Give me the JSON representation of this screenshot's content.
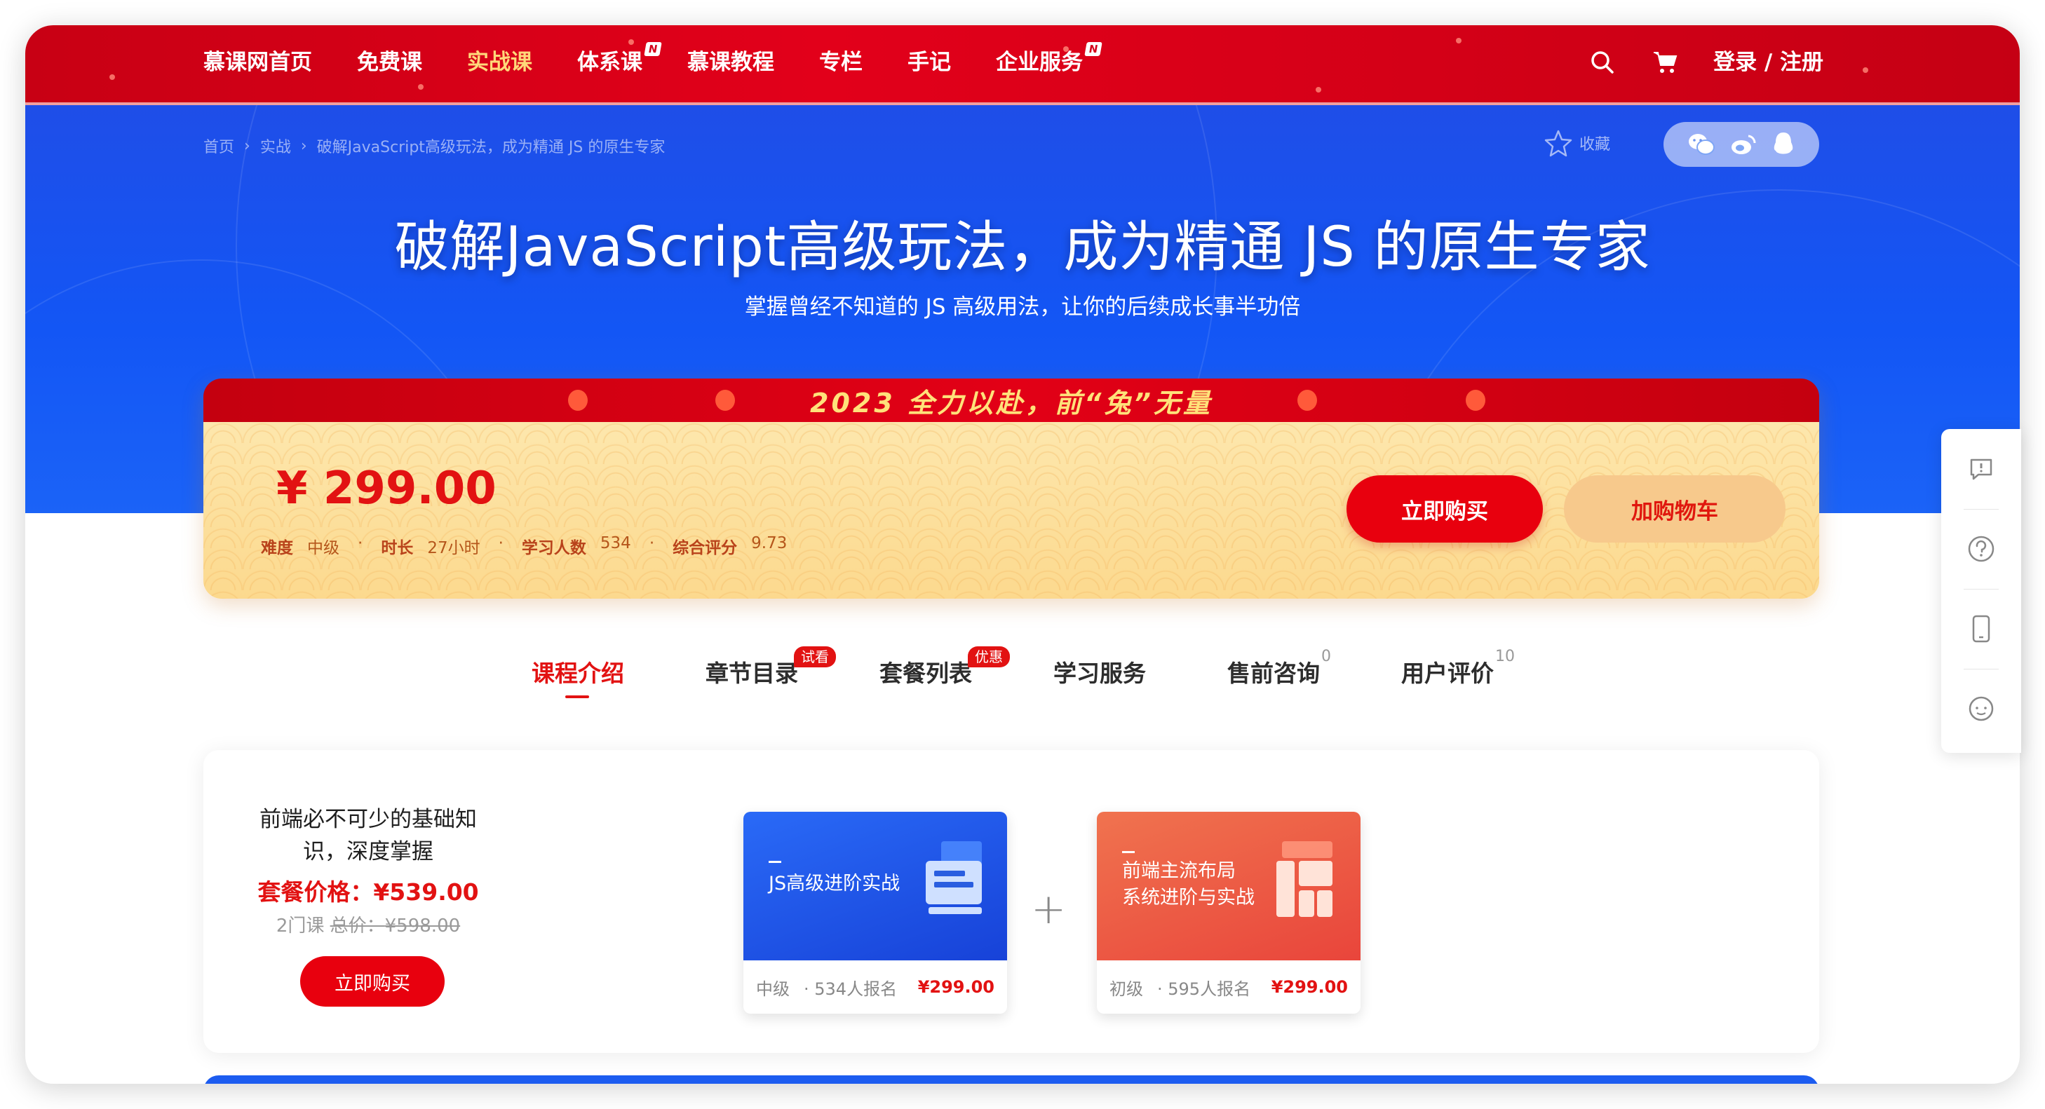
{
  "nav": {
    "items": [
      {
        "label": "慕课网首页",
        "active": false,
        "new": false
      },
      {
        "label": "免费课",
        "active": false,
        "new": false
      },
      {
        "label": "实战课",
        "active": true,
        "new": false
      },
      {
        "label": "体系课",
        "active": false,
        "new": true
      },
      {
        "label": "慕课教程",
        "active": false,
        "new": false
      },
      {
        "label": "专栏",
        "active": false,
        "new": false
      },
      {
        "label": "手记",
        "active": false,
        "new": false
      },
      {
        "label": "企业服务",
        "active": false,
        "new": true
      }
    ],
    "new_badge": "N",
    "login": "登录 / 注册"
  },
  "breadcrumb": {
    "home": "首页",
    "category": "实战",
    "current": "破解JavaScript高级玩法，成为精通 JS 的原生专家",
    "sep": "›"
  },
  "favorite_label": "收藏",
  "hero": {
    "title": "破解JavaScript高级玩法，成为精通 JS 的原生专家",
    "subtitle": "掌握曾经不知道的 JS 高级用法，让你的后续成长事半功倍"
  },
  "promo": {
    "text": "2023 全力以赴，前“兔”无量"
  },
  "price": {
    "amount": "¥ 299.00",
    "meta": [
      {
        "k": "难度",
        "v": "中级"
      },
      {
        "k": "时长",
        "v": "27小时"
      },
      {
        "k": "学习人数",
        "v": "534"
      },
      {
        "k": "综合评分",
        "v": "9.73"
      }
    ],
    "dot": "·",
    "buy": "立即购买",
    "cart": "加购物车"
  },
  "tabs": [
    {
      "label": "课程介绍",
      "active": true
    },
    {
      "label": "章节目录",
      "badge": "试看"
    },
    {
      "label": "套餐列表",
      "badge": "优惠"
    },
    {
      "label": "学习服务"
    },
    {
      "label": "售前咨询",
      "count": "0"
    },
    {
      "label": "用户评价",
      "count": "10"
    }
  ],
  "package": {
    "title": "前端必不可少的基础知识，深度掌握",
    "price": "套餐价格：¥539.00",
    "count": "2门课",
    "orig_label": "总价：",
    "orig": "¥598.00",
    "buy": "立即购买",
    "plus": "+",
    "courses": [
      {
        "name": "JS高级进阶实战",
        "level": "中级",
        "students": "· 534人报名",
        "price": "¥299.00"
      },
      {
        "name": "前端主流布局\n系统进阶与实战",
        "level": "初级",
        "students": "· 595人报名",
        "price": "¥299.00"
      }
    ]
  },
  "colors": {
    "nav_red": "#e2001a",
    "hero_blue": "#1356f5",
    "price_red": "#e21212",
    "active_nav": "#ffd87a"
  },
  "icons": {
    "search": "search-icon",
    "cart": "cart-icon",
    "star": "star-icon",
    "wechat": "wechat-icon",
    "weibo": "weibo-icon",
    "qq": "qq-icon",
    "feedback": "feedback-icon",
    "help": "help-icon",
    "mobile": "mobile-icon",
    "chat": "chat-icon"
  }
}
